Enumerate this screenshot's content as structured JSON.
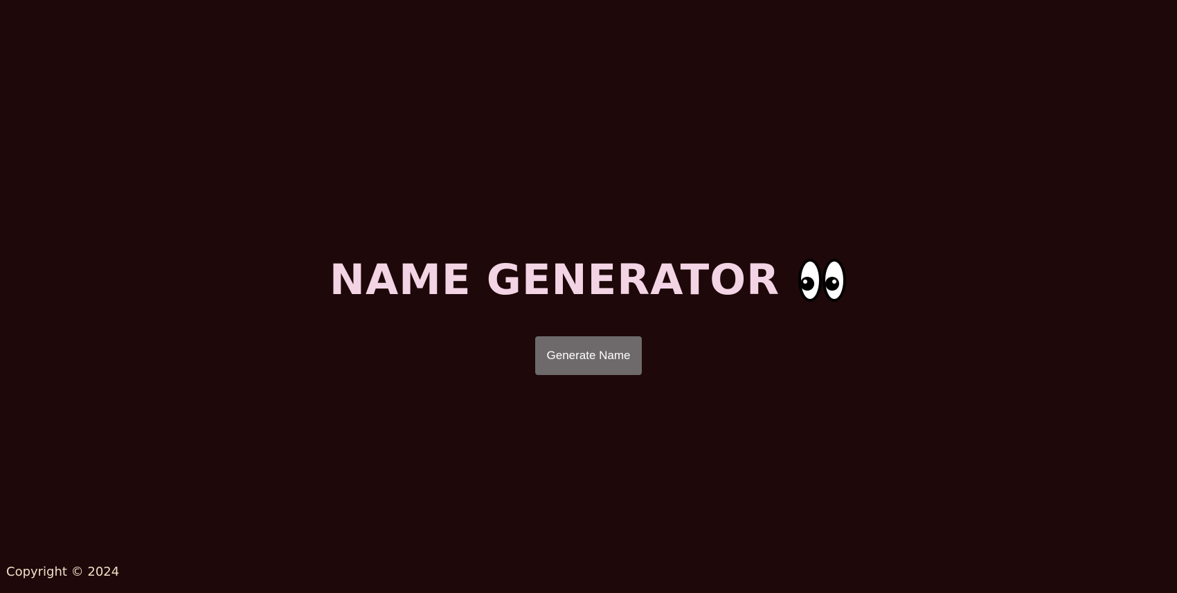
{
  "header": {
    "title": "NAME GENERATOR",
    "title_icon": "eyes-emoji",
    "title_color": "#f3d4e4"
  },
  "main": {
    "generate_button_label": "Generate Name",
    "button_color": "#6e6a6b"
  },
  "footer": {
    "copyright": "Copyright © 2024",
    "text_color": "#f3dfc9"
  },
  "theme": {
    "background": "#1e0809"
  }
}
